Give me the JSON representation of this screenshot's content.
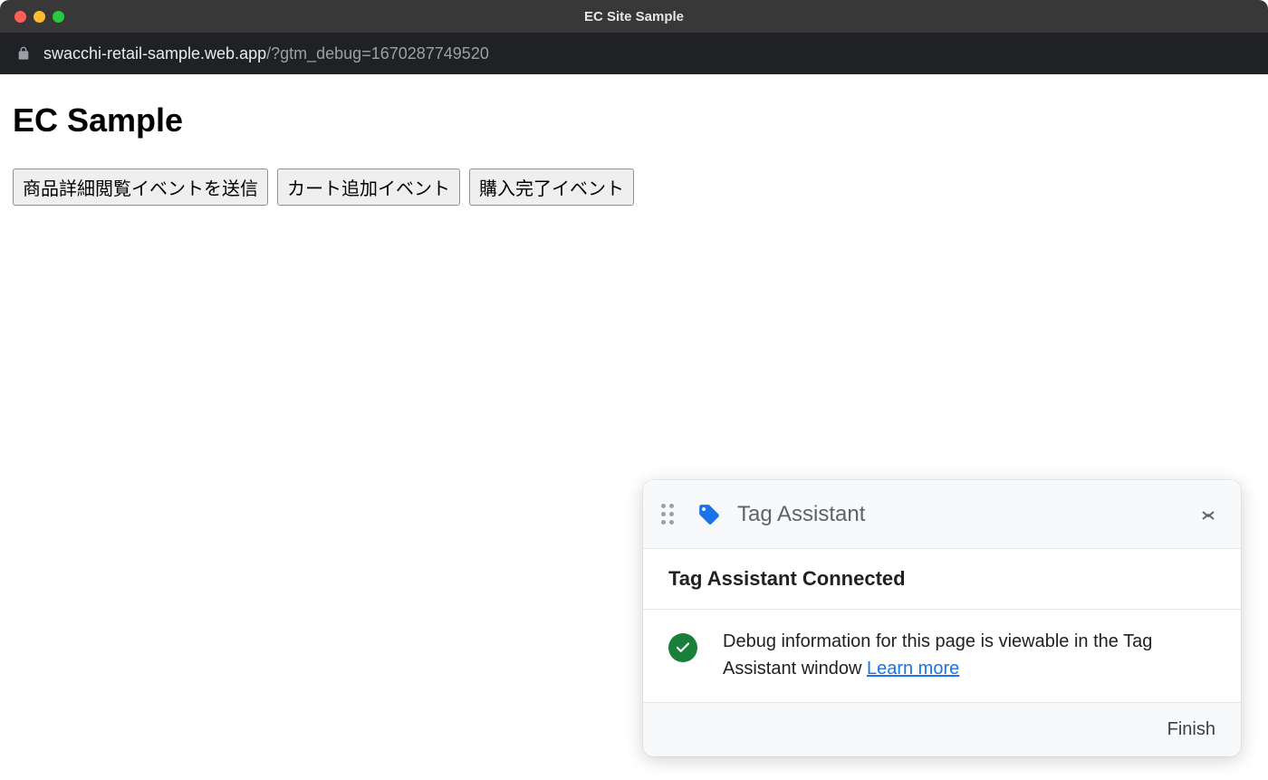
{
  "window": {
    "title": "EC Site Sample"
  },
  "address": {
    "host": "swacchi-retail-sample.web.app",
    "path": "/?gtm_debug=1670287749520"
  },
  "page": {
    "heading": "EC Sample",
    "buttons": [
      "商品詳細閲覧イベントを送信",
      "カート追加イベント",
      "購入完了イベント"
    ]
  },
  "tagAssistant": {
    "title": "Tag Assistant",
    "connected_heading": "Tag Assistant Connected",
    "message": "Debug information for this page is viewable in the Tag Assistant window ",
    "learn_more": "Learn more",
    "finish": "Finish"
  }
}
